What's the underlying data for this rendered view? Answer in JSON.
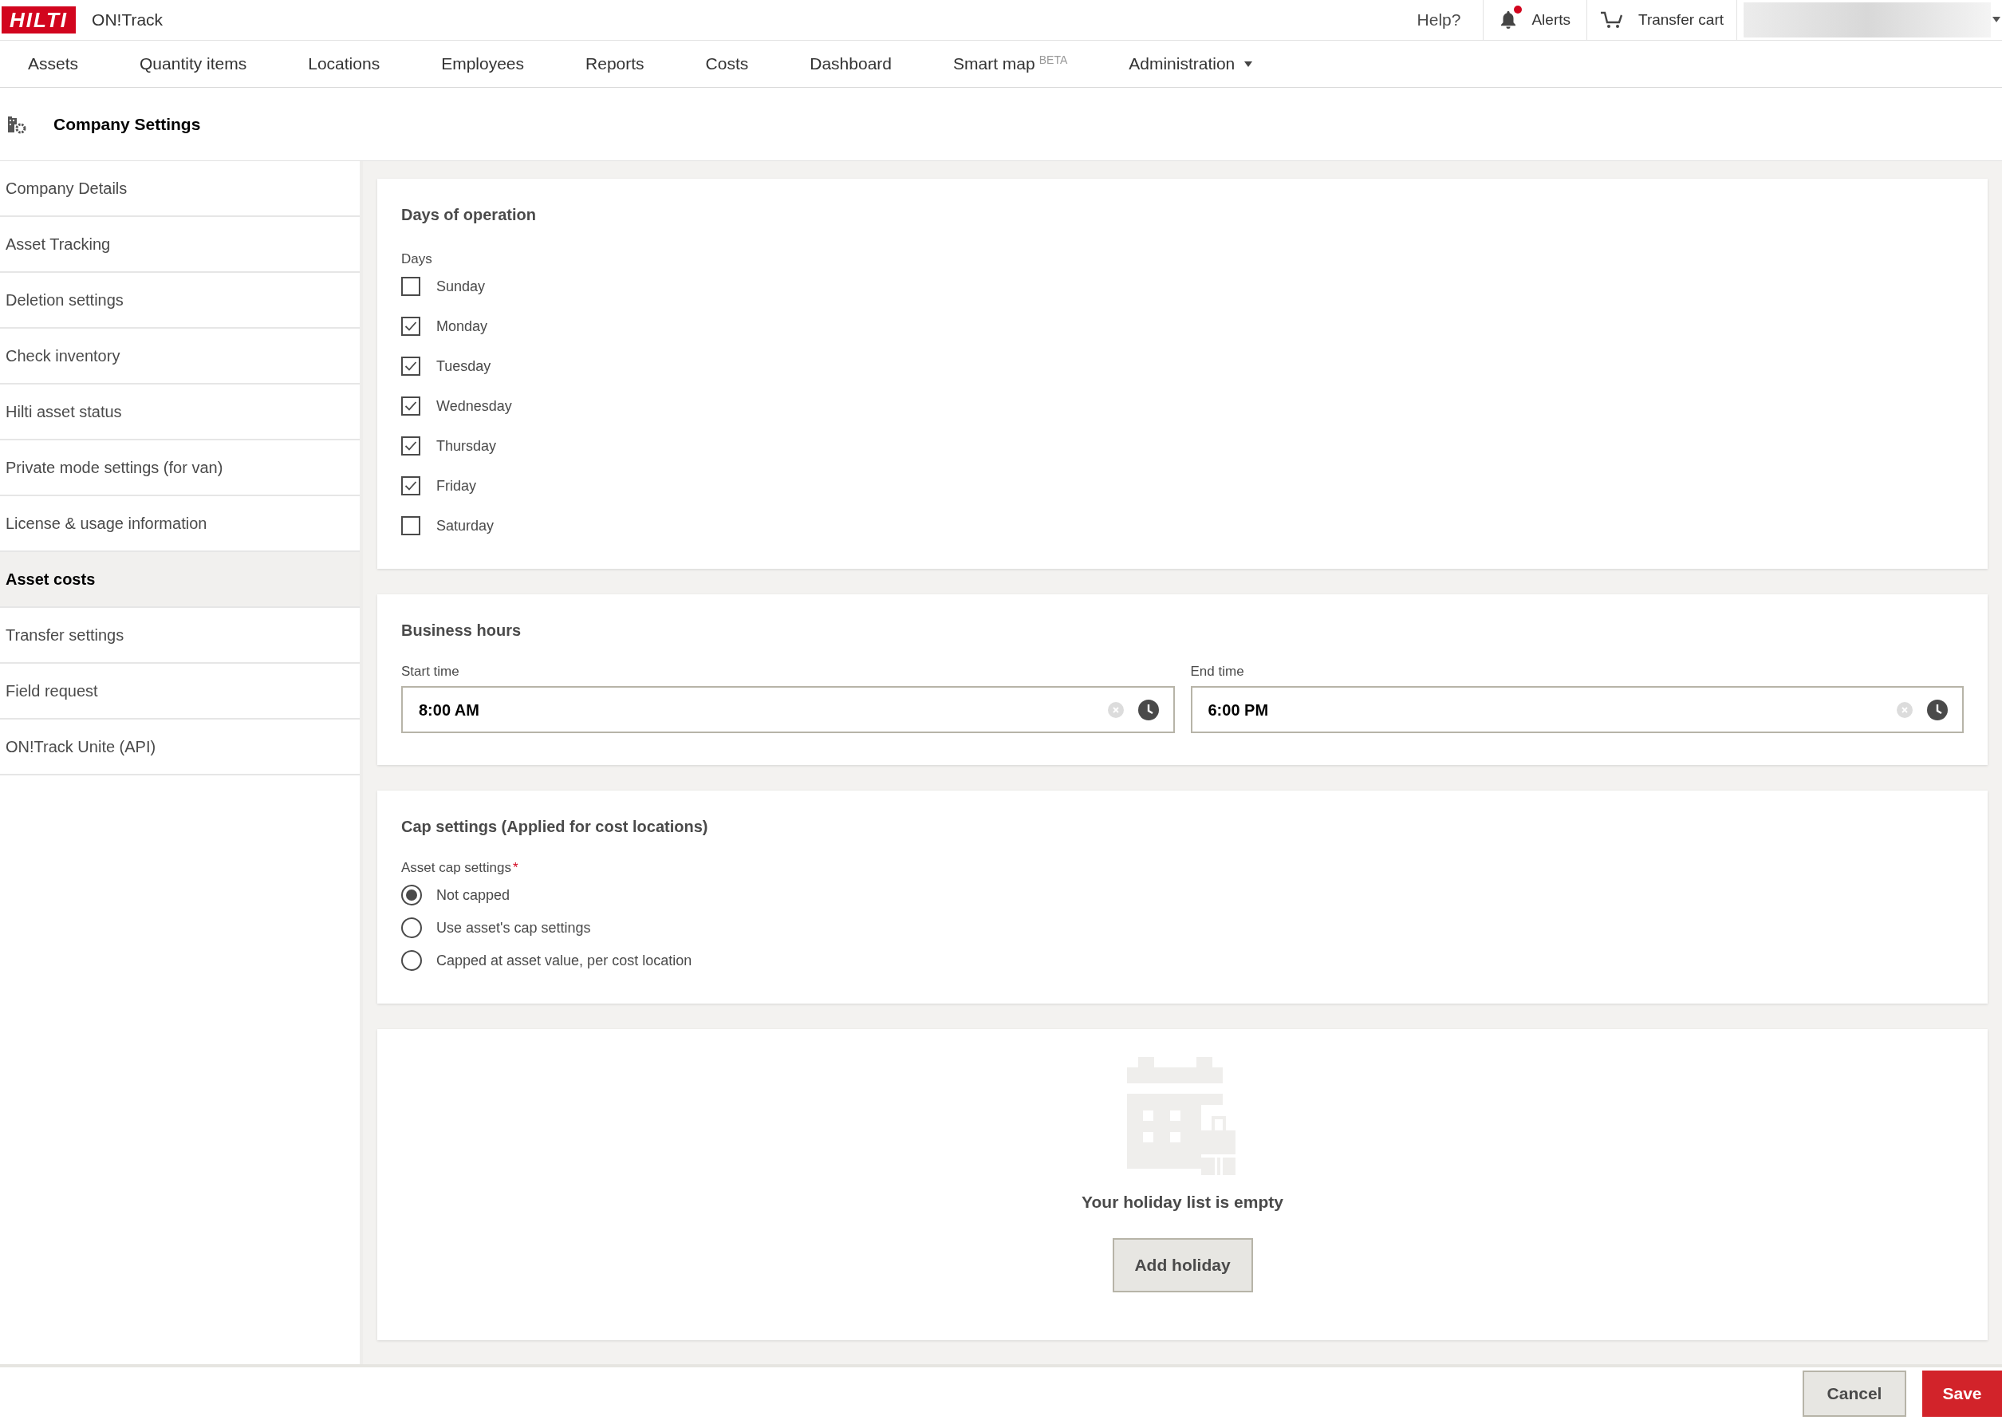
{
  "topbar": {
    "logo": "HILTI",
    "app_name": "ON!Track",
    "help": "Help?",
    "alerts": {
      "label": "Alerts",
      "unread": true
    },
    "cart": "Transfer cart"
  },
  "nav": [
    {
      "label": "Assets",
      "selected": false
    },
    {
      "label": "Quantity items",
      "selected": false
    },
    {
      "label": "Locations",
      "selected": false
    },
    {
      "label": "Employees",
      "selected": false
    },
    {
      "label": "Reports",
      "selected": false
    },
    {
      "label": "Costs",
      "selected": false
    },
    {
      "label": "Dashboard",
      "selected": false
    },
    {
      "label": "Smart map",
      "badge": "BETA",
      "selected": false
    },
    {
      "label": "Administration",
      "dropdown": true,
      "selected": false
    }
  ],
  "page_title": "Company Settings",
  "sidebar": {
    "items": [
      {
        "label": "Company Details",
        "selected": false
      },
      {
        "label": "Asset Tracking",
        "selected": false
      },
      {
        "label": "Deletion settings",
        "selected": false
      },
      {
        "label": "Check inventory",
        "selected": false
      },
      {
        "label": "Hilti asset status",
        "selected": false
      },
      {
        "label": "Private mode settings (for van)",
        "selected": false
      },
      {
        "label": "License & usage information",
        "selected": false
      },
      {
        "label": "Asset costs",
        "selected": true
      },
      {
        "label": "Transfer settings",
        "selected": false
      },
      {
        "label": "Field request",
        "selected": false
      },
      {
        "label": "ON!Track Unite (API)",
        "selected": false
      }
    ]
  },
  "days_card": {
    "title": "Days of operation",
    "label": "Days",
    "days": [
      {
        "label": "Sunday",
        "checked": false
      },
      {
        "label": "Monday",
        "checked": true
      },
      {
        "label": "Tuesday",
        "checked": true
      },
      {
        "label": "Wednesday",
        "checked": true
      },
      {
        "label": "Thursday",
        "checked": true
      },
      {
        "label": "Friday",
        "checked": true
      },
      {
        "label": "Saturday",
        "checked": false
      }
    ]
  },
  "hours_card": {
    "title": "Business hours",
    "fields": [
      {
        "label": "Start time",
        "value": "8:00 AM"
      },
      {
        "label": "End time",
        "value": "6:00 PM"
      }
    ]
  },
  "cap_card": {
    "title": "Cap settings (Applied for cost locations)",
    "label": "Asset cap settings",
    "required_mark": "*",
    "options": [
      {
        "label": "Not capped",
        "selected": true
      },
      {
        "label": "Use asset's cap settings",
        "selected": false
      },
      {
        "label": "Capped at asset value, per cost location",
        "selected": false
      }
    ]
  },
  "holiday_card": {
    "empty_text": "Your holiday list is empty",
    "button": "Add holiday"
  },
  "footer": {
    "cancel": "Cancel",
    "save": "Save"
  }
}
